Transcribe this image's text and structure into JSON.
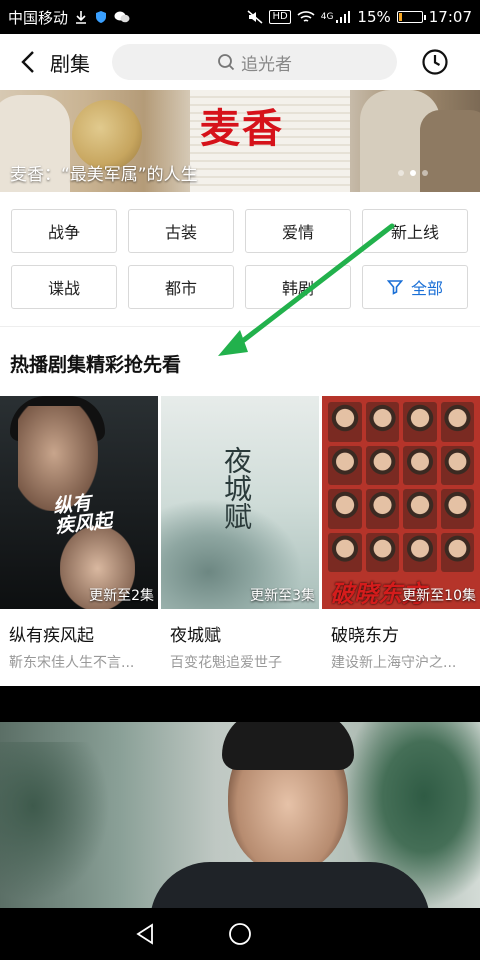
{
  "status_bar": {
    "carrier": "中国移动",
    "battery_percent": "15%",
    "time": "17:07",
    "network": "4G",
    "hd_label": "HD",
    "battery_level": 0.15,
    "battery_color": "#f6a623"
  },
  "header": {
    "title": "剧集",
    "search_placeholder": "追光者",
    "icons": [
      "back-icon",
      "search-icon",
      "history-clock-icon"
    ]
  },
  "banner": {
    "title_text": "麦香",
    "caption": "麦香：“最美军属”的人生",
    "dots": [
      false,
      true,
      false
    ]
  },
  "categories": [
    {
      "label": "战争"
    },
    {
      "label": "古装"
    },
    {
      "label": "爱情"
    },
    {
      "label": "新上线"
    },
    {
      "label": "谍战"
    },
    {
      "label": "都市"
    },
    {
      "label": "韩剧"
    },
    {
      "label": "全部",
      "icon": "filter-icon",
      "accent": "#1a6fd6"
    }
  ],
  "section": {
    "title": "热播剧集精彩抢先看"
  },
  "cards": [
    {
      "title": "纵有疾风起",
      "subtitle": "靳东宋佳人生不言...",
      "badge": "更新至2集",
      "poster_text": "纵有疾风起"
    },
    {
      "title": "夜城赋",
      "subtitle": "百变花魁追爱世子",
      "badge": "更新至3集",
      "poster_text": "夜城赋"
    },
    {
      "title": "破晓东方",
      "subtitle": "建设新上海守沪之...",
      "badge": "更新至10集",
      "poster_text": "破晓东方"
    }
  ],
  "video": {
    "watermark": "",
    "subtitle": ""
  },
  "annotation": {
    "arrow_color": "#22b14c"
  }
}
